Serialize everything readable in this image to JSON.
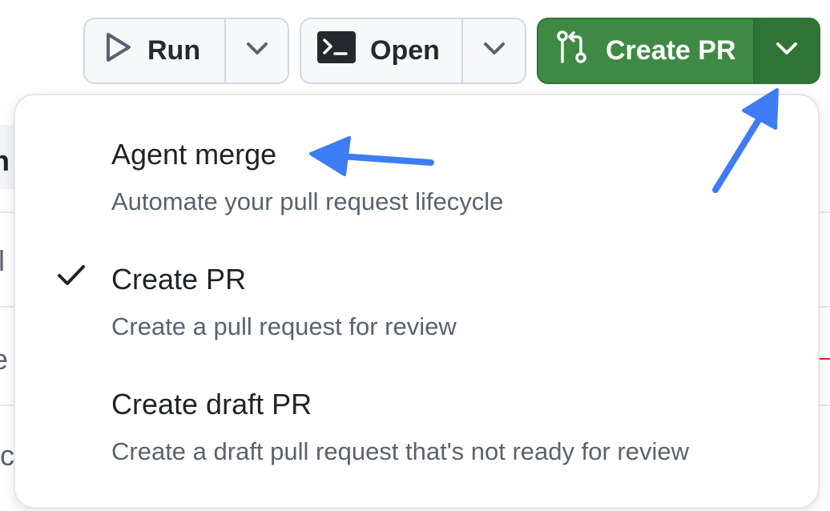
{
  "toolbar": {
    "run": {
      "label": "Run",
      "icon": "play-icon",
      "dropdown_icon": "chevron-down-icon"
    },
    "open": {
      "label": "Open",
      "icon": "terminal-icon",
      "dropdown_icon": "chevron-down-icon"
    },
    "create_pr": {
      "label": "Create PR",
      "icon": "git-pull-request-icon",
      "dropdown_icon": "chevron-down-icon",
      "color": "#3e8a44"
    }
  },
  "menu": {
    "items": [
      {
        "title": "Agent merge",
        "description": "Automate your pull request lifecycle",
        "selected": false
      },
      {
        "title": "Create PR",
        "description": "Create a pull request for review",
        "selected": true
      },
      {
        "title": "Create draft PR",
        "description": "Create a draft pull request that's not ready for review",
        "selected": false
      }
    ]
  },
  "background_fragments": [
    "n",
    "il",
    "e",
    "/c"
  ],
  "colors": {
    "accent_green": "#3e8a44",
    "annotation_arrow": "#3d7cf5",
    "muted_text": "#59636e"
  }
}
